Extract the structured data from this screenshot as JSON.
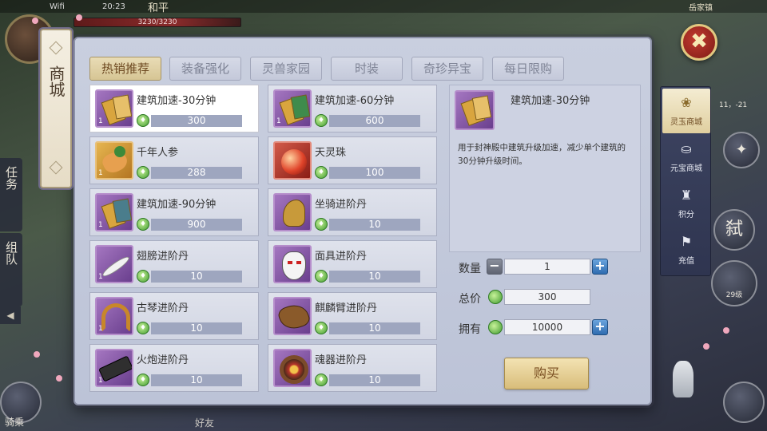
{
  "status_bar": {
    "wifi": "Wifi",
    "time": "20:23",
    "mode": "和平",
    "location": "岳家镇"
  },
  "player": {
    "hp_text": "3230/3230"
  },
  "hud": {
    "task_label": "任务",
    "team_label": "组队",
    "left_arrow": "◀",
    "kill_label": "弑",
    "lock_level": "29级",
    "mount_label": "骑乘",
    "friend_label": "好友",
    "coords": "11，-21"
  },
  "shop": {
    "title": "商城",
    "close_icon": "✖",
    "tabs": [
      {
        "label": "热销推荐",
        "active": true
      },
      {
        "label": "装备强化",
        "active": false
      },
      {
        "label": "灵兽家园",
        "active": false
      },
      {
        "label": "时装",
        "active": false
      },
      {
        "label": "奇珍异宝",
        "active": false
      },
      {
        "label": "每日限购",
        "active": false
      }
    ],
    "items": [
      {
        "name": "建筑加速-30分钟",
        "price": "300",
        "count": "1",
        "icon": "scroll-icon",
        "selected": true
      },
      {
        "name": "建筑加速-60分钟",
        "price": "600",
        "count": "1",
        "icon": "scroll-icon",
        "selected": false
      },
      {
        "name": "千年人参",
        "price": "288",
        "count": "1",
        "icon": "ginseng-icon",
        "selected": false
      },
      {
        "name": "天灵珠",
        "price": "100",
        "count": "",
        "icon": "pearl-icon",
        "selected": false
      },
      {
        "name": "建筑加速-90分钟",
        "price": "900",
        "count": "1",
        "icon": "scroll-icon",
        "selected": false
      },
      {
        "name": "坐骑进阶丹",
        "price": "10",
        "count": "",
        "icon": "horse-icon",
        "selected": false
      },
      {
        "name": "翅膀进阶丹",
        "price": "10",
        "count": "1",
        "icon": "feather-icon",
        "selected": false
      },
      {
        "name": "面具进阶丹",
        "price": "10",
        "count": "",
        "icon": "mask-icon",
        "selected": false
      },
      {
        "name": "古琴进阶丹",
        "price": "10",
        "count": "1",
        "icon": "harp-icon",
        "selected": false
      },
      {
        "name": "麒麟臂进阶丹",
        "price": "10",
        "count": "",
        "icon": "arm-icon",
        "selected": false
      },
      {
        "name": "火炮进阶丹",
        "price": "10",
        "count": "1",
        "icon": "cannon-icon",
        "selected": false
      },
      {
        "name": "魂器进阶丹",
        "price": "10",
        "count": "",
        "icon": "soul-icon",
        "selected": false
      }
    ],
    "detail": {
      "title": "建筑加速-30分钟",
      "description": "用于封神殿中建筑升级加速，减少单个建筑的30分钟升级时间。"
    },
    "purchase": {
      "quantity_label": "数量",
      "quantity_value": "1",
      "total_label": "总价",
      "total_value": "300",
      "owned_label": "拥有",
      "owned_value": "10000",
      "minus_icon": "−",
      "plus_icon": "+",
      "buy_label": "购买"
    },
    "side_tabs": [
      {
        "label": "灵玉商城",
        "icon": "jade-icon",
        "active": true
      },
      {
        "label": "元宝商城",
        "icon": "ingot-icon",
        "active": false
      },
      {
        "label": "积分",
        "icon": "points-bag-icon",
        "active": false
      },
      {
        "label": "充值",
        "icon": "recharge-icon",
        "active": false
      }
    ]
  },
  "colors": {
    "active_tab": "#d6c594",
    "price_bar": "#9ea6bf",
    "coin_green": "#3f9a2e",
    "item_frame_purple": "#a476c0",
    "close_red": "#c23b30"
  }
}
